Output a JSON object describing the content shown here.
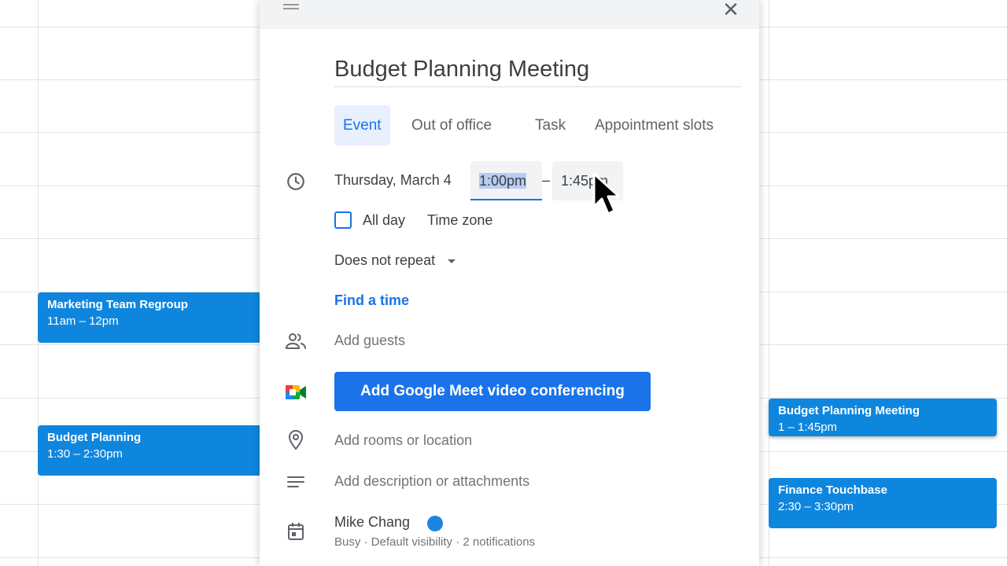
{
  "calendar": {
    "events_left": [
      {
        "title": "Marketing Team Regroup",
        "time": "11am – 12pm"
      },
      {
        "title": "Budget Planning",
        "time": "1:30 – 2:30pm"
      }
    ],
    "events_right": [
      {
        "title": "Budget Planning Meeting",
        "time": "1 – 1:45pm"
      },
      {
        "title": "Finance Touchbase",
        "time": "2:30 – 3:30pm"
      }
    ],
    "event_color": "#0f86de"
  },
  "dialog": {
    "close_label": "✕",
    "title": "Budget Planning Meeting",
    "tabs": [
      {
        "label": "Event",
        "active": true
      },
      {
        "label": "Out of office",
        "active": false
      },
      {
        "label": "Task",
        "active": false
      },
      {
        "label": "Appointment slots",
        "active": false
      }
    ],
    "date": "Thursday, March 4",
    "start_time": "1:00pm",
    "time_separator": "–",
    "end_time": "1:45pm",
    "all_day_label": "All day",
    "all_day_checked": false,
    "time_zone_label": "Time zone",
    "repeat_label": "Does not repeat",
    "find_time_label": "Find a time",
    "add_guests_label": "Add guests",
    "meet_button_label": "Add Google Meet video conferencing",
    "location_label": "Add rooms or location",
    "description_label": "Add description or attachments",
    "calendar_owner": "Mike Chang",
    "calendar_color": "#1a86e0",
    "calendar_details": "Busy · Default visibility · 2 notifications",
    "accent_color": "#1a73e8"
  }
}
